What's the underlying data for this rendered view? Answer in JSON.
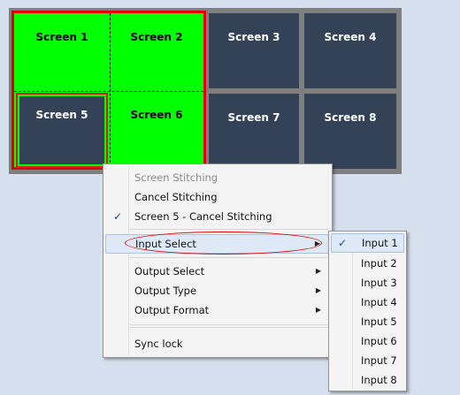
{
  "colors": {
    "background": "#d6dfee",
    "wall_border": "#7f7f7f",
    "screen_dark": "#344258",
    "screen_stitched": "#00ff00",
    "stitch_outline": "#e10000",
    "menu_bg": "#f4f4f4",
    "menu_highlight": "#dde9f7"
  },
  "screens": [
    {
      "label": "Screen 1",
      "stitched": true
    },
    {
      "label": "Screen 2",
      "stitched": true
    },
    {
      "label": "Screen 3",
      "stitched": false
    },
    {
      "label": "Screen 4",
      "stitched": false
    },
    {
      "label": "Screen 5",
      "stitched": false
    },
    {
      "label": "Screen 6",
      "stitched": true
    },
    {
      "label": "Screen 7",
      "stitched": false
    },
    {
      "label": "Screen 8",
      "stitched": false
    }
  ],
  "context_menu": {
    "items": [
      {
        "label": "Screen Stitching",
        "disabled": true
      },
      {
        "label": "Cancel Stitching"
      },
      {
        "label": "Screen 5 - Cancel Stitching",
        "checked": true
      },
      {
        "label": "Input Select",
        "submenu": true,
        "highlighted": true
      },
      {
        "label": "Output Select",
        "submenu": true
      },
      {
        "label": "Output Type",
        "submenu": true
      },
      {
        "label": "Output Format",
        "submenu": true
      },
      {
        "label": "Sync lock"
      }
    ],
    "check_glyph": "✓",
    "arrow_glyph": "▶"
  },
  "input_submenu": {
    "items": [
      {
        "label": "Input 1",
        "checked": true
      },
      {
        "label": "Input 2"
      },
      {
        "label": "Input 3"
      },
      {
        "label": "Input 4"
      },
      {
        "label": "Input 5"
      },
      {
        "label": "Input 6"
      },
      {
        "label": "Input 7"
      },
      {
        "label": "Input 8"
      }
    ],
    "selected": "Input 1"
  }
}
